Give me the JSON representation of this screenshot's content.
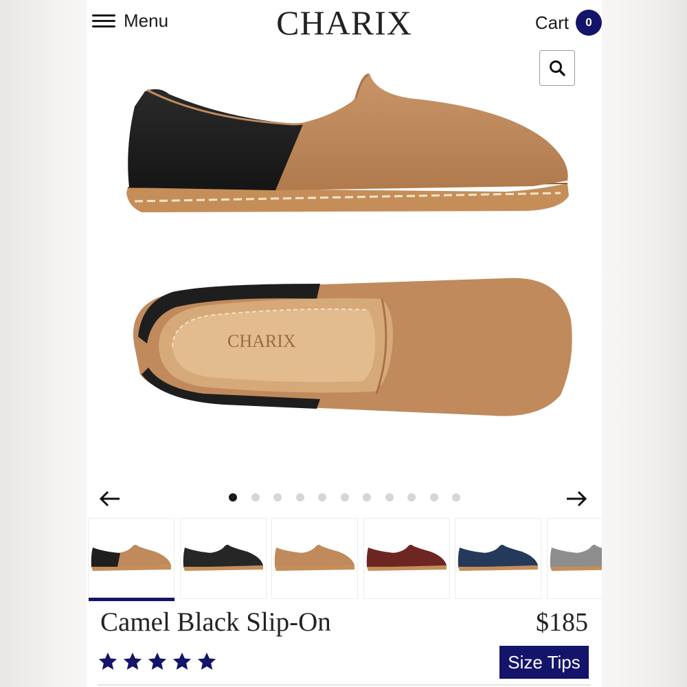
{
  "header": {
    "menu_label": "Menu",
    "brand": "CHARIX",
    "cart_label": "Cart",
    "cart_count": "0"
  },
  "icons": {
    "menu": "hamburger-icon",
    "search": "search-icon",
    "prev": "arrow-left-icon",
    "next": "arrow-right-icon",
    "rating": "star-icon"
  },
  "gallery": {
    "insole_logo": "CHARIX",
    "slide_count": 11,
    "active_slide": 1,
    "thumbnails": [
      {
        "colorway": "camel-black",
        "upper": "#c08a5c",
        "heel": "#1f1f1f",
        "selected": true
      },
      {
        "colorway": "black",
        "upper": "#262626",
        "heel": "#262626",
        "selected": false
      },
      {
        "colorway": "camel",
        "upper": "#c08a5c",
        "heel": "#c08a5c",
        "selected": false
      },
      {
        "colorway": "burgundy",
        "upper": "#6e2622",
        "heel": "#6e2622",
        "selected": false
      },
      {
        "colorway": "navy",
        "upper": "#25395a",
        "heel": "#25395a",
        "selected": false
      },
      {
        "colorway": "gray",
        "upper": "#8e8e8e",
        "heel": "#8e8e8e",
        "selected": false
      }
    ]
  },
  "product": {
    "title": "Camel Black Slip-On",
    "price": "$185",
    "rating": 5,
    "rating_max": 5,
    "size_tips_label": "Size Tips"
  },
  "colors": {
    "accent": "#14146b",
    "camel": "#c08a5c",
    "black_leather": "#1f1f1f"
  }
}
